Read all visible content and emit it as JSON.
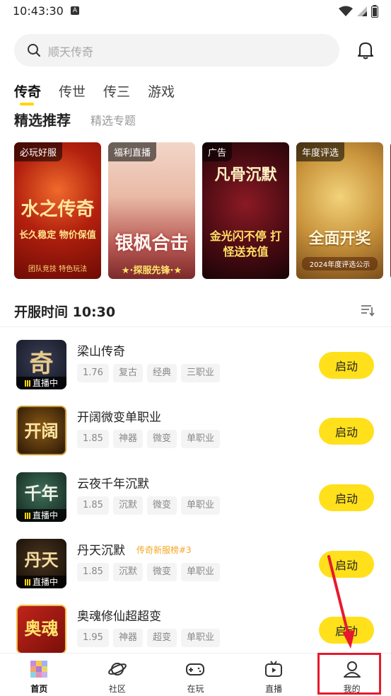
{
  "status_bar": {
    "time": "10:43:30",
    "notif_letter": "A"
  },
  "search": {
    "placeholder": "顺天传奇"
  },
  "top_tabs": [
    "传奇",
    "传世",
    "传三",
    "游戏"
  ],
  "section": {
    "title": "精选推荐",
    "sub": "精选专题"
  },
  "banners": [
    {
      "tag": "必玩好服",
      "title": "水之传奇",
      "sub": "长久稳定 物价保值",
      "foot": "团队竞技 特色玩法"
    },
    {
      "tag": "福利直播",
      "title": "银枫合击",
      "sub": "★·探服先锋·★",
      "foot": ""
    },
    {
      "tag": "广告",
      "title": "凡骨沉默",
      "sub": "金光闪不停 打怪送充值",
      "foot": ""
    },
    {
      "tag": "年度评选",
      "title": "全面开奖",
      "sub": "2024年度评选公示",
      "foot": ""
    }
  ],
  "server": {
    "label": "开服时间  10:30"
  },
  "games": [
    {
      "name": "梁山传奇",
      "version": "1.76",
      "tags": [
        "复古",
        "经典",
        "三职业"
      ],
      "glyph": "奇",
      "live": "直播中",
      "rank": "",
      "button": "启动"
    },
    {
      "name": "开阔微变单职业",
      "version": "1.85",
      "tags": [
        "神器",
        "微变",
        "单职业"
      ],
      "glyph": "开阔",
      "live": "",
      "rank": "",
      "button": "启动"
    },
    {
      "name": "云夜千年沉默",
      "version": "1.85",
      "tags": [
        "沉默",
        "微变",
        "单职业"
      ],
      "glyph": "千年",
      "live": "直播中",
      "rank": "",
      "button": "启动"
    },
    {
      "name": "丹天沉默",
      "version": "1.85",
      "tags": [
        "沉默",
        "微变",
        "单职业"
      ],
      "glyph": "丹天",
      "live": "直播中",
      "rank": "传奇新服榜#3",
      "button": "启动"
    },
    {
      "name": "奥魂修仙超超变",
      "version": "1.95",
      "tags": [
        "神器",
        "超变",
        "单职业"
      ],
      "glyph": "奥魂",
      "live": "",
      "rank": "",
      "button": "启动"
    }
  ],
  "nav": [
    {
      "label": "首页",
      "icon": "home-icon"
    },
    {
      "label": "社区",
      "icon": "planet-icon"
    },
    {
      "label": "在玩",
      "icon": "gamepad-icon"
    },
    {
      "label": "直播",
      "icon": "tv-play-icon"
    },
    {
      "label": "我的",
      "icon": "user-icon"
    }
  ],
  "colors": {
    "accent": "#ffe01b",
    "annotation": "#e8192c",
    "rank": "#f5a623"
  }
}
